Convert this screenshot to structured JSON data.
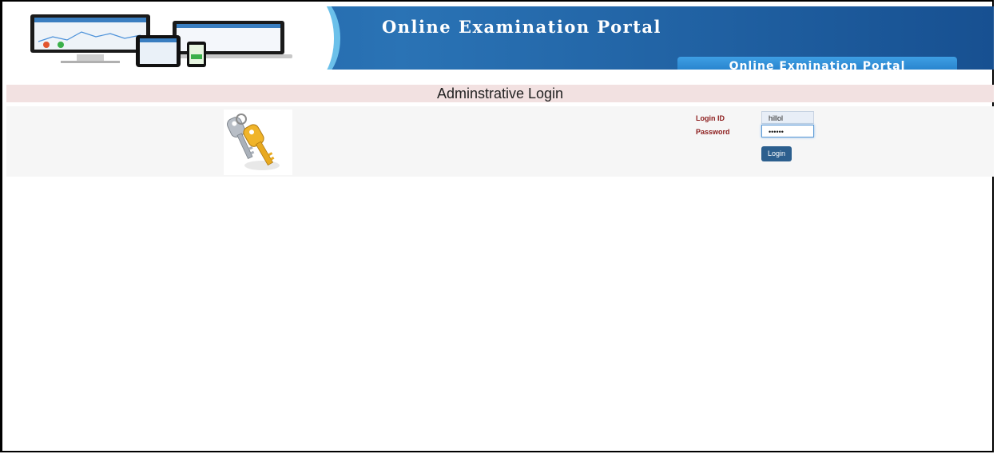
{
  "header": {
    "title": "Online Examination Portal",
    "tab_label": "Online Exmination Portal"
  },
  "page": {
    "heading": "Adminstrative Login"
  },
  "form": {
    "login_id_label": "Login ID",
    "login_id_value": "hillol",
    "password_label": "Password",
    "password_value": "••••••",
    "login_button": "Login"
  },
  "colors": {
    "banner": "#1c5b9e",
    "heading_bar": "#f2e1e1",
    "label_red": "#8b1a1a",
    "button": "#2c5f8e"
  }
}
